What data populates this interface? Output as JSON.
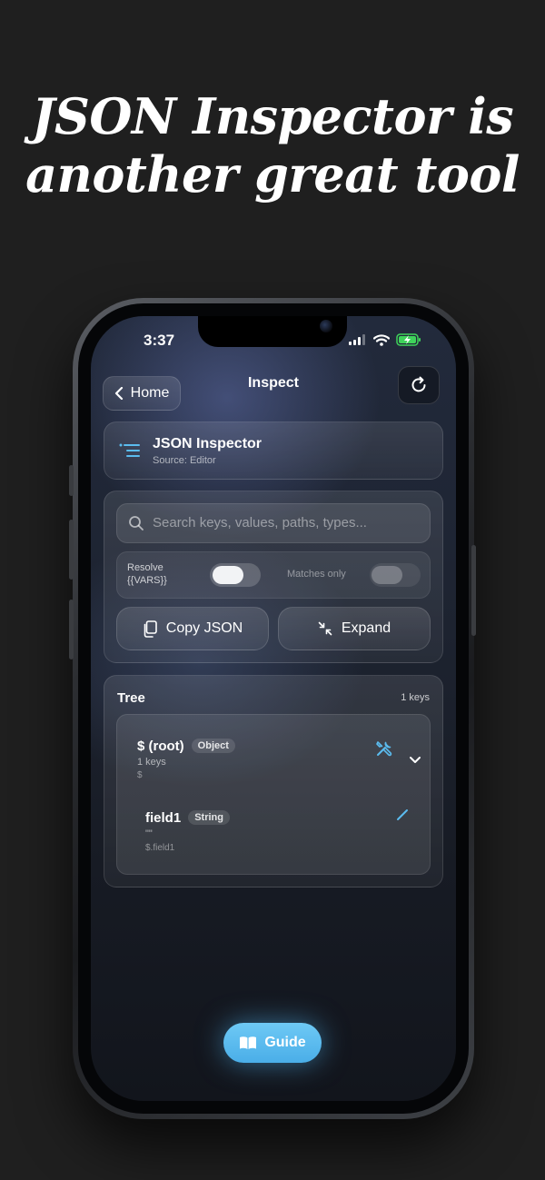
{
  "headline": {
    "line1": "JSON Inspector is",
    "line2": "another great tool"
  },
  "status_bar": {
    "time": "3:37"
  },
  "nav": {
    "back_label": "Home",
    "title": "Inspect"
  },
  "source_card": {
    "title": "JSON Inspector",
    "subtitle": "Source: Editor"
  },
  "controls": {
    "search_placeholder": "Search keys, values, paths, types...",
    "resolve_label_line1": "Resolve",
    "resolve_label_line2": "{{VARS}}",
    "resolve_on": true,
    "matches_only_label": "Matches only",
    "matches_only_on": false,
    "copy_button_label": "Copy JSON",
    "expand_button_label": "Expand"
  },
  "tree": {
    "title": "Tree",
    "count_label": "1 keys",
    "nodes": [
      {
        "name": "$ (root)",
        "type": "Object",
        "summary": "1 keys",
        "path": "$"
      },
      {
        "name": "field1",
        "type": "String",
        "summary": "\"\"",
        "path": "$.field1"
      }
    ]
  },
  "guide_button_label": "Guide",
  "colors": {
    "accent": "#5bbcef",
    "background": "#1f1f1f"
  }
}
